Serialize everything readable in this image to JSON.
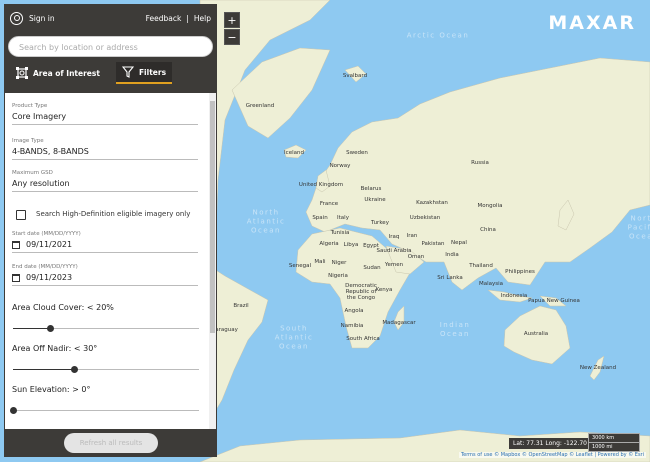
{
  "header": {
    "sign_in": "Sign in",
    "feedback": "Feedback",
    "separator": "|",
    "help": "Help",
    "search_placeholder": "Search by location or address"
  },
  "tabs": [
    {
      "label": "Area of Interest",
      "icon": "area-of-interest-icon"
    },
    {
      "label": "Filters",
      "icon": "funnel-icon",
      "active": true
    }
  ],
  "filters": {
    "product_type": {
      "label": "Product Type",
      "value": "Core Imagery"
    },
    "image_type": {
      "label": "Image Type",
      "value": "4-BANDS, 8-BANDS"
    },
    "max_gsd": {
      "label": "Maximum GSD",
      "value": "Any resolution"
    },
    "hd_only": {
      "label": "Search High-Definition eligible imagery only",
      "checked": false
    },
    "start_date": {
      "label": "Start date (MM/DD/YYYY)",
      "value": "09/11/2021"
    },
    "end_date": {
      "label": "End date (MM/DD/YYYY)",
      "value": "09/11/2023"
    },
    "cloud_cover": {
      "label": "Area Cloud Cover: < 20%",
      "level_percent": 20
    },
    "off_nadir": {
      "label": "Area Off Nadir: < 30°",
      "level_percent": 33
    },
    "sun_elevation": {
      "label": "Sun Elevation: > 0°",
      "level_percent": 0
    }
  },
  "refresh_label": "Refresh all results",
  "map": {
    "logo": "MAXAR",
    "zoom_in": "+",
    "zoom_out": "−",
    "coordinates": "Lat: 77.31 Long: -122.70",
    "scale_km": "3000 km",
    "scale_mi": "1000 mi",
    "attribution": "Terms of use © Mapbox © OpenStreetMap © Leaflet | Powered by © Esri",
    "water_color": "#8ec9f1",
    "land_color": "#eeefd6",
    "oceans": [
      "Arctic Ocean",
      "North\nAtlantic\nOcean",
      "South\nAtlantic\nOcean",
      "Indian\nOcean",
      "North\nPacific\nOcean"
    ],
    "countries": [
      "Greenland",
      "Svalbard",
      "Iceland",
      "Norway",
      "Sweden",
      "Russia",
      "United Kingdom",
      "Belarus",
      "Ukraine",
      "France",
      "Spain",
      "Italy",
      "Kazakhstan",
      "Mongolia",
      "Uzbekistan",
      "Turkey",
      "China",
      "Tunisia",
      "Algeria",
      "Libya",
      "Egypt",
      "Iraq",
      "Iran",
      "Pakistan",
      "Nepal",
      "Saudi Arabia",
      "Oman",
      "India",
      "Senegal",
      "Mali",
      "Niger",
      "Yemen",
      "Thailand",
      "Philippines",
      "Sudan",
      "Nigeria",
      "Sri Lanka",
      "Malaysia",
      "Indonesia",
      "Democratic Republic of the Congo",
      "Kenya",
      "Brazil",
      "Papua New Guinea",
      "Angola",
      "Namibia",
      "Madagascar",
      "Australia",
      "South Africa",
      "New Zealand",
      "Paraguay"
    ]
  }
}
